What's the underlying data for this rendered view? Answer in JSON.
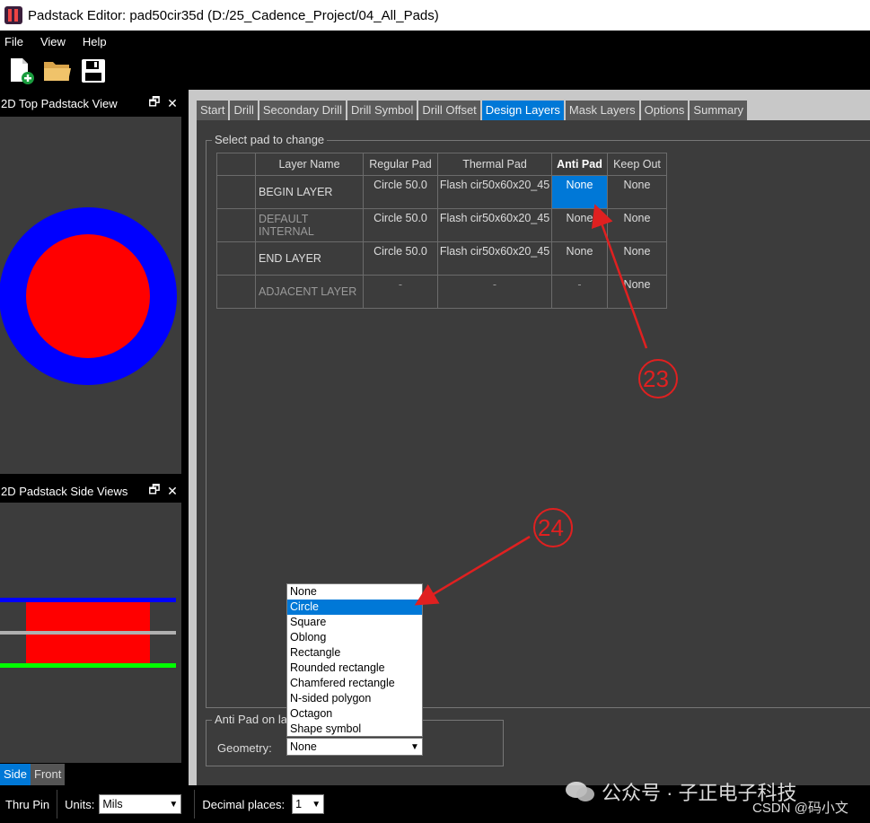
{
  "window": {
    "title": "Padstack Editor: pad50cir35d  (D:/25_Cadence_Project/04_All_Pads)"
  },
  "menu": [
    "File",
    "View",
    "Help"
  ],
  "panels": {
    "top_view_title": "2D Top Padstack View",
    "side_view_title": "2D Padstack Side Views",
    "side_tabs": [
      "Side",
      "Front"
    ],
    "active_side_tab": "Side"
  },
  "tabs": [
    "Start",
    "Drill",
    "Secondary Drill",
    "Drill Symbol",
    "Drill Offset",
    "Design Layers",
    "Mask Layers",
    "Options",
    "Summary"
  ],
  "active_tab": "Design Layers",
  "select_group": {
    "title": "Select pad to change"
  },
  "table": {
    "headers": [
      "",
      "Layer Name",
      "Regular Pad",
      "Thermal Pad",
      "Anti Pad",
      "Keep Out"
    ],
    "rows": [
      {
        "layer": "BEGIN LAYER",
        "regular": "Circle 50.0",
        "thermal": "Flash cir50x60x20_45",
        "anti": "None",
        "keepout": "None"
      },
      {
        "layer": "DEFAULT INTERNAL",
        "regular": "Circle 50.0",
        "thermal": "Flash cir50x60x20_45",
        "anti": "None",
        "keepout": "None"
      },
      {
        "layer": "END LAYER",
        "regular": "Circle 50.0",
        "thermal": "Flash cir50x60x20_45",
        "anti": "None",
        "keepout": "None"
      },
      {
        "layer": "ADJACENT LAYER",
        "regular": "-",
        "thermal": "-",
        "anti": "-",
        "keepout": "None"
      }
    ]
  },
  "anti_pad_group": {
    "title": "Anti Pad on la",
    "geometry_label": "Geometry:",
    "geometry_value": "None",
    "options": [
      "None",
      "Circle",
      "Square",
      "Oblong",
      "Rectangle",
      "Rounded rectangle",
      "Chamfered rectangle",
      "N-sided polygon",
      "Octagon",
      "Shape symbol"
    ],
    "highlighted_option": "Circle"
  },
  "status": {
    "pin_type": "Thru Pin",
    "units_label": "Units:",
    "units_value": "Mils",
    "decimal_label": "Decimal places:",
    "decimal_value": "1"
  },
  "annotations": [
    "23",
    "24"
  ],
  "watermark": {
    "wechat": "公众号 · 子正电子科技",
    "csdn": "CSDN @码小文"
  },
  "colors": {
    "accent": "#0078d7",
    "pad_fill": "#ff0000",
    "antipad_ring": "#0000ff",
    "annotation": "#e02020",
    "bottom_layer": "#00ff00"
  }
}
